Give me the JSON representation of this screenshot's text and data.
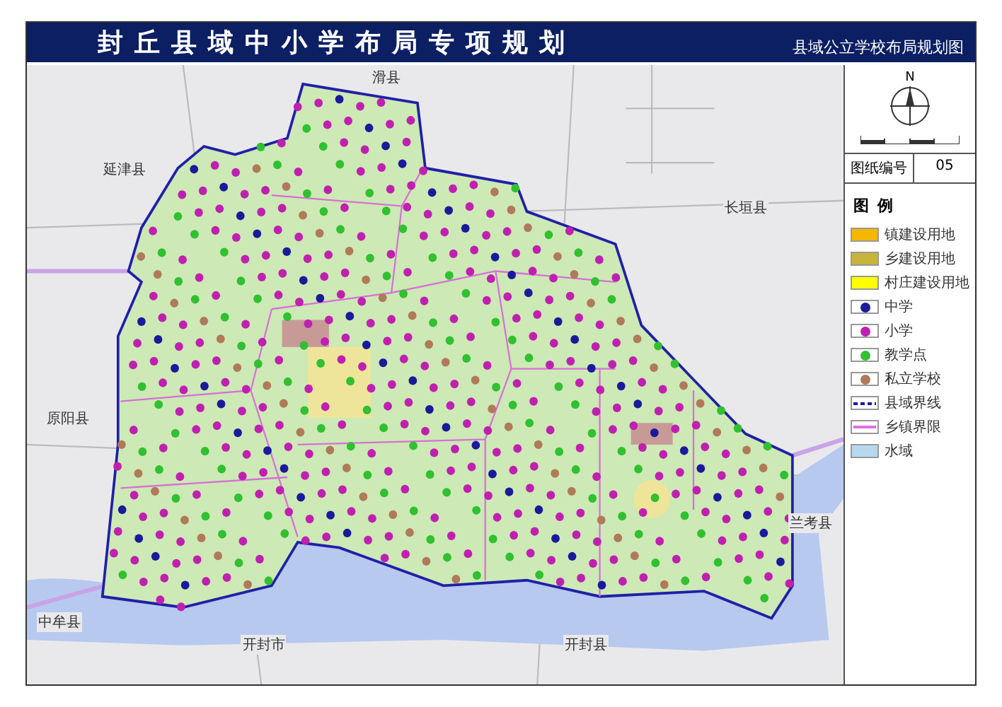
{
  "title_bar": {
    "title": "封丘县域中小学布局专项规划",
    "subtitle": "县域公立学校布局规划图"
  },
  "map": {
    "place_labels": [
      "滑县",
      "延津县",
      "长垣县",
      "原阳县",
      "兰考县",
      "中牟县",
      "开封市",
      "开封县"
    ]
  },
  "sidebar": {
    "north_label": "N",
    "sheet_number_label": "图纸编号",
    "sheet_number": "05",
    "legend_title": "图例",
    "legend": [
      {
        "kind": "area",
        "label": "镇建设用地",
        "color": "#f5b700"
      },
      {
        "kind": "area",
        "label": "乡建设用地",
        "color": "#c8b43c"
      },
      {
        "kind": "area",
        "label": "村庄建设用地",
        "color": "#ffff00"
      },
      {
        "kind": "dot",
        "label": "中学",
        "color": "#1a1a9a"
      },
      {
        "kind": "dot",
        "label": "小学",
        "color": "#c020b0"
      },
      {
        "kind": "dot",
        "label": "教学点",
        "color": "#30c030"
      },
      {
        "kind": "dot",
        "label": "私立学校",
        "color": "#b07a5a"
      },
      {
        "kind": "dashed-line",
        "label": "县域界线",
        "color": "#1a1aa0"
      },
      {
        "kind": "line",
        "label": "乡镇界限",
        "color": "#e070e0"
      },
      {
        "kind": "area",
        "label": "水域",
        "color": "#b8d8f0"
      }
    ]
  }
}
